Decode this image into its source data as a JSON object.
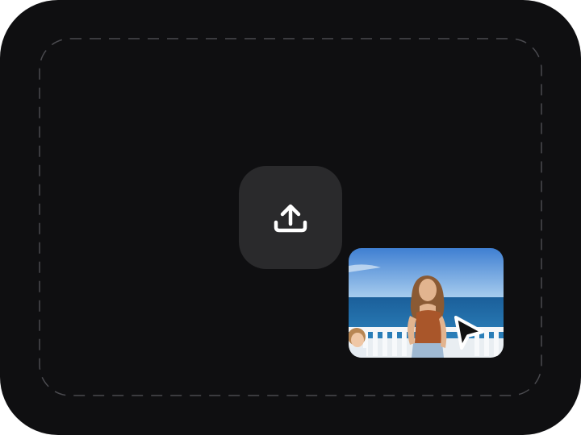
{
  "dropzone": {
    "upload_icon": "upload-tray-icon",
    "cursor_icon": "pointer-cursor-icon",
    "thumbnail": "photo-thumbnail"
  },
  "colors": {
    "background": "#0f0f11",
    "button": "#2a2a2c",
    "dash": "#4a4a4f",
    "icon": "#ffffff",
    "cursor": "#111111"
  }
}
